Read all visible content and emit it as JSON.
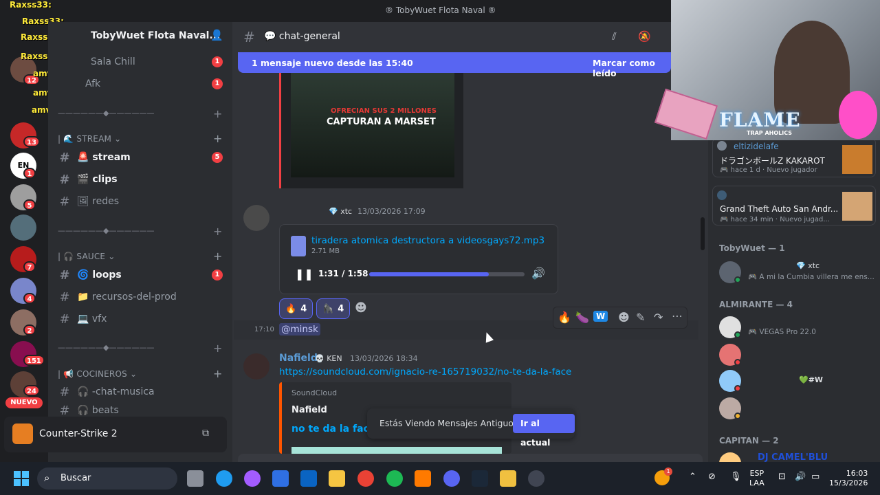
{
  "window": {
    "title": "® TobyWuet Flota Naval ®"
  },
  "overlay_chat": [
    {
      "user": "Raxss33:"
    },
    {
      "user": "Raxss33:"
    },
    {
      "user": "Raxss33:"
    },
    {
      "user": "Raxss33:"
    },
    {
      "user": "amvu:"
    },
    {
      "user": "amvu:"
    },
    {
      "user": "amvu:"
    }
  ],
  "guilds": {
    "badges": [
      "12",
      "13",
      "1",
      "5",
      "7",
      "7",
      "4",
      "2",
      "151",
      "24"
    ],
    "new_label": "NUEVO",
    "en_label": "EN"
  },
  "server": {
    "name": "TobyWuet Flota Naval..."
  },
  "channels": {
    "top": [
      {
        "name": "Sala Chill",
        "badge": "1"
      },
      {
        "name": "Afk",
        "badge": "1"
      }
    ],
    "sep1": "——————◆——————",
    "cat_stream": "STREAM",
    "stream": [
      {
        "name": "stream",
        "emoji": "🚨",
        "badge": "5"
      },
      {
        "name": "clips",
        "emoji": "🎬",
        "badge": ""
      },
      {
        "name": "redes",
        "emoji": "🖼",
        "badge": ""
      }
    ],
    "sep2": "——————◆——————",
    "cat_sauce": "SAUCE",
    "sauce": [
      {
        "name": "loops",
        "emoji": "🌀",
        "badge": "1"
      },
      {
        "name": "recursos-del-prod",
        "emoji": "📁",
        "badge": ""
      },
      {
        "name": "vfx",
        "emoji": "💻",
        "badge": ""
      }
    ],
    "sep3": "——————◆——————",
    "cat_cocineros": "COCINEROS",
    "cocineros": [
      {
        "name": "-chat-musica",
        "emoji": "🎧",
        "badge": ""
      },
      {
        "name": "beats",
        "emoji": "🎧",
        "badge": "1"
      }
    ]
  },
  "game": {
    "name": "Counter-Strike 2"
  },
  "header": {
    "channel": "chat-general"
  },
  "banner": {
    "text": "1 mensaje nuevo desde las 15:40",
    "action": "Marcar como leído"
  },
  "thumb": {
    "line1": "OFRECIAN SUS 2 MILLONES",
    "line2": "CAPTURAN A MARSET"
  },
  "msg1": {
    "tag": "xtc",
    "time": "13/03/2026 17:09"
  },
  "audio": {
    "filename": "tiradera atomica destructora a videosgays72.mp3",
    "size": "2.71 MB",
    "time": "1:31 / 1:58",
    "progress": 0.77
  },
  "reactions": [
    {
      "emoji": "🔥",
      "count": "4"
    },
    {
      "emoji": "🦍",
      "count": "4"
    }
  ],
  "msg2": {
    "time": "17:10",
    "mention": "@minsk"
  },
  "msg3": {
    "author": "Nafield",
    "tag": "KEN",
    "time": "13/03/2026 18:34",
    "link": "https://soundcloud.com/ignacio-re-165719032/no-te-da-la-face",
    "embed_provider": "SoundCloud",
    "embed_author": "Nafield",
    "embed_title": "no te da la face"
  },
  "jump": {
    "text": "Estás Viendo Mensajes Antiguos",
    "button": "Ir al actual"
  },
  "webcam": {
    "banner": "FLAME",
    "sub": "TRAP AHOLICS"
  },
  "activity": [
    {
      "user": "eltizidelafe",
      "title": "ドラゴンボールZ KAKAROT",
      "meta": "hace 1 d",
      "status": "Nuevo jugador"
    },
    {
      "user": "",
      "title": "Grand Theft Auto San Andr...",
      "meta": "hace 34 min",
      "status": "Nuevo jugad..."
    }
  ],
  "members": {
    "g1": "TobyWuet — 1",
    "m1_tag": "xtc",
    "m1_status": "A mi la Cumbia villera me ens...",
    "g2": "ALMIRANTE — 4",
    "m2_status": "VEGAS Pro 22.0",
    "m4_tag": "#W",
    "g3": "CAPITAN — 2",
    "m5_name": "DJ CAMEL'BLU"
  },
  "taskbar": {
    "search": "Buscar",
    "lang1": "ESP",
    "lang2": "LAA",
    "time": "16:03",
    "date": "15/3/2026",
    "badge": "1"
  }
}
